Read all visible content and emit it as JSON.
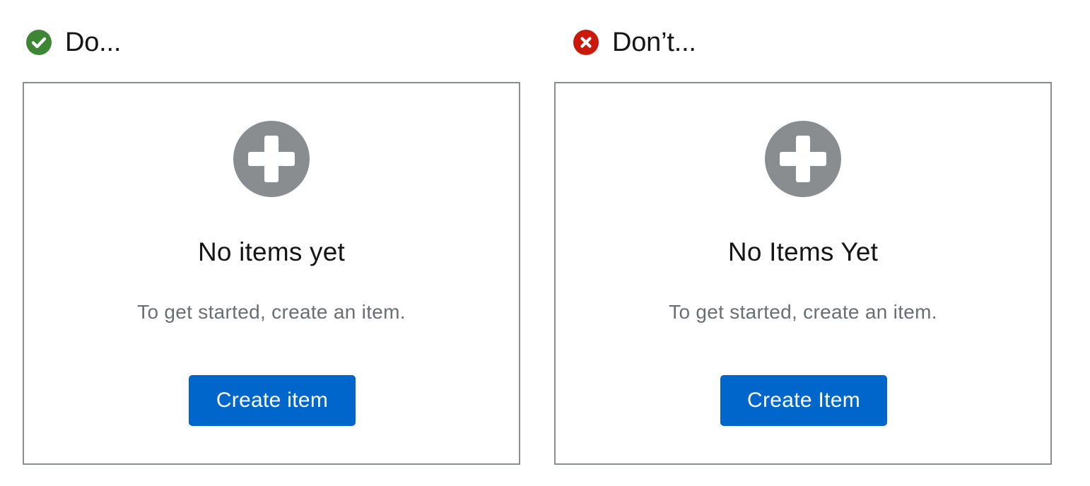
{
  "colors": {
    "do_accent": "#3e8635",
    "dont_accent": "#c9190b",
    "icon_gray": "#8a8d90",
    "button_blue": "#0066cc",
    "border_gray": "#8a8d90",
    "title_text": "#151515",
    "body_text": "#6a6e73"
  },
  "examples": [
    {
      "heading": "Do...",
      "badge_icon": "check-circle-icon",
      "card": {
        "icon": "plus-circle-icon",
        "title": "No items yet",
        "body": "To get started, create an item.",
        "button_label": "Create item"
      }
    },
    {
      "heading": "Don’t...",
      "badge_icon": "times-circle-icon",
      "card": {
        "icon": "plus-circle-icon",
        "title": "No Items Yet",
        "body": "To get started, create an item.",
        "button_label": "Create Item"
      }
    }
  ]
}
